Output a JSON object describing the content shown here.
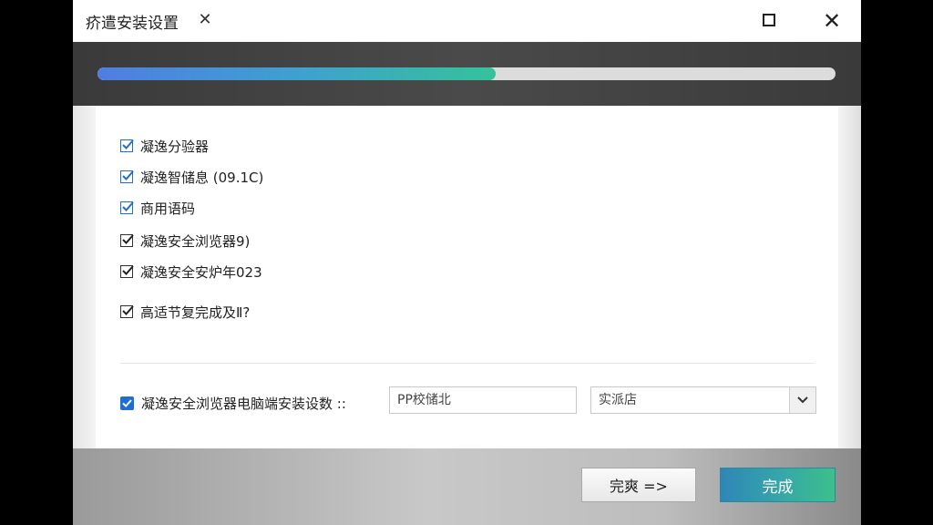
{
  "window": {
    "title": "疥遣安装设置",
    "tab_close_symbol": "✕",
    "maximize_icon": "maximize-icon",
    "close_symbol": "✕"
  },
  "progress": {
    "value_fraction": 0.54,
    "fill_colors": [
      "#4f7ee0",
      "#35c29a"
    ]
  },
  "options": [
    {
      "label": "凝逸分验器",
      "checked": true,
      "style": "blue"
    },
    {
      "label": "凝逸智储息 (09.1C)",
      "checked": true,
      "style": "blue"
    },
    {
      "label": "商用语码",
      "checked": true,
      "style": "blue"
    },
    {
      "label": "凝逸安全浏览器9)",
      "checked": true,
      "style": "dark"
    },
    {
      "label": "凝逸安全安炉年023",
      "checked": true,
      "style": "dark"
    },
    {
      "label": "高适节复完成及Ⅱ?",
      "checked": true,
      "style": "dark"
    }
  ],
  "install_setting": {
    "label": "凝逸安全浏览器电脑端安装设数 ::",
    "checked": true,
    "path_value": "PP校储北",
    "select_value": "实派店"
  },
  "buttons": {
    "next_label": "完爽 =>",
    "finish_label": "完成"
  },
  "colors": {
    "accent_blue": "#1f6fd1",
    "finish_start": "#2f86b8",
    "finish_end": "#3cbf8c",
    "progress_band": "#3a3a3a"
  }
}
